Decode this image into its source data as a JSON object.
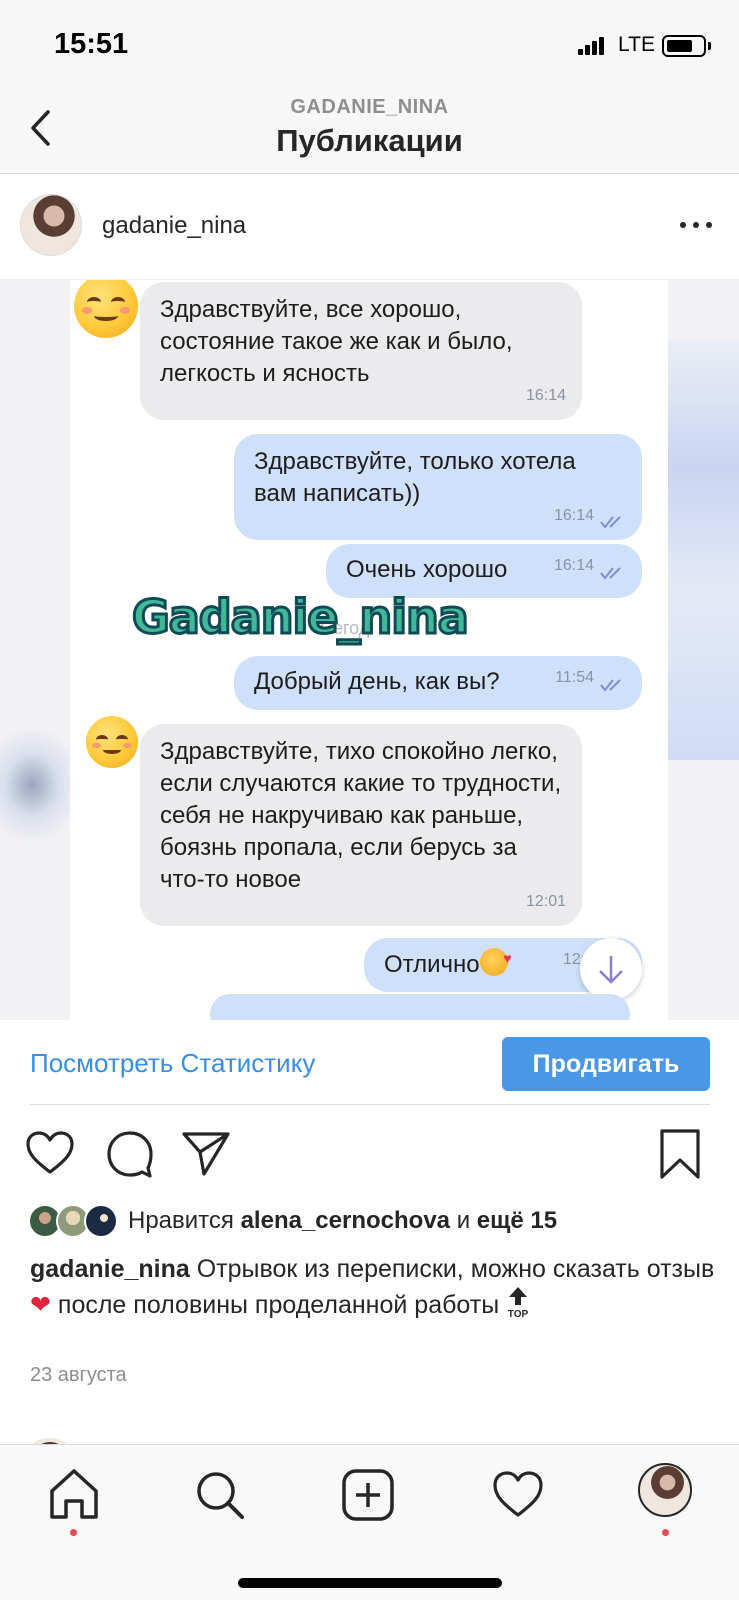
{
  "status_bar": {
    "time": "15:51",
    "network": "LTE"
  },
  "nav": {
    "subtitle": "GADANIE_NINA",
    "title": "Публикации"
  },
  "post": {
    "username": "gadanie_nina",
    "image": {
      "messages": [
        {
          "direction": "in",
          "text": "Здравствуйте, все хорошо, состояние такое же как и было, легкость и ясность",
          "time": "16:14"
        },
        {
          "direction": "out",
          "text": "Здравствуйте, только хотела вам написать))",
          "time": "16:14"
        },
        {
          "direction": "out",
          "text": "Очень хорошо",
          "time": "16:14"
        },
        {
          "direction": "out",
          "text": "Добрый день, как вы?",
          "time": "11:54"
        },
        {
          "direction": "in",
          "text": "Здравствуйте, тихо спокойно легко, если случаются какие то трудности, себя не накручиваю как раньше, боязнь пропала, если берусь за что-то новое",
          "time": "12:01"
        },
        {
          "direction": "out",
          "text": "Отлично",
          "time": "12:1"
        }
      ],
      "date_separator": "Сегод",
      "watermark": "Gadanie_nina"
    },
    "insights": {
      "view_stats": "Посмотреть Статистику",
      "promote": "Продвигать"
    },
    "likes": {
      "prefix": "Нравится",
      "user": "alena_cernochova",
      "joiner": "и",
      "others": "ещё 15"
    },
    "caption": {
      "username": "gadanie_nina",
      "text_before_heart": "Отрывок из переписки, можно сказать отзыв",
      "heart": "❤",
      "text_after_heart": "после половины проделанной работы",
      "top_label": "TOP"
    },
    "date": "23 августа"
  },
  "icons": {
    "back": "chevron-left-icon",
    "more": "more-dots-icon",
    "like": "heart-icon",
    "comment": "comment-icon",
    "share": "paper-plane-icon",
    "save": "bookmark-icon",
    "home": "home-icon",
    "search": "search-icon",
    "add": "add-post-icon",
    "activity": "heart-icon"
  },
  "colors": {
    "link": "#3a8ee6",
    "button": "#4a97e6",
    "notification": "#ed4956",
    "outgoing_bubble": "#cfe0fb",
    "incoming_bubble": "#ebebed"
  }
}
